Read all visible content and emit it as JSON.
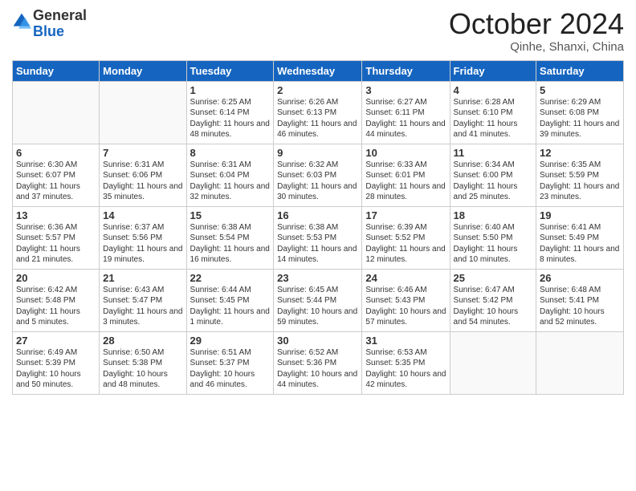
{
  "header": {
    "logo_general": "General",
    "logo_blue": "Blue",
    "month_title": "October 2024",
    "location": "Qinhe, Shanxi, China"
  },
  "weekdays": [
    "Sunday",
    "Monday",
    "Tuesday",
    "Wednesday",
    "Thursday",
    "Friday",
    "Saturday"
  ],
  "weeks": [
    [
      {
        "day": "",
        "info": ""
      },
      {
        "day": "",
        "info": ""
      },
      {
        "day": "1",
        "info": "Sunrise: 6:25 AM\nSunset: 6:14 PM\nDaylight: 11 hours and 48 minutes."
      },
      {
        "day": "2",
        "info": "Sunrise: 6:26 AM\nSunset: 6:13 PM\nDaylight: 11 hours and 46 minutes."
      },
      {
        "day": "3",
        "info": "Sunrise: 6:27 AM\nSunset: 6:11 PM\nDaylight: 11 hours and 44 minutes."
      },
      {
        "day": "4",
        "info": "Sunrise: 6:28 AM\nSunset: 6:10 PM\nDaylight: 11 hours and 41 minutes."
      },
      {
        "day": "5",
        "info": "Sunrise: 6:29 AM\nSunset: 6:08 PM\nDaylight: 11 hours and 39 minutes."
      }
    ],
    [
      {
        "day": "6",
        "info": "Sunrise: 6:30 AM\nSunset: 6:07 PM\nDaylight: 11 hours and 37 minutes."
      },
      {
        "day": "7",
        "info": "Sunrise: 6:31 AM\nSunset: 6:06 PM\nDaylight: 11 hours and 35 minutes."
      },
      {
        "day": "8",
        "info": "Sunrise: 6:31 AM\nSunset: 6:04 PM\nDaylight: 11 hours and 32 minutes."
      },
      {
        "day": "9",
        "info": "Sunrise: 6:32 AM\nSunset: 6:03 PM\nDaylight: 11 hours and 30 minutes."
      },
      {
        "day": "10",
        "info": "Sunrise: 6:33 AM\nSunset: 6:01 PM\nDaylight: 11 hours and 28 minutes."
      },
      {
        "day": "11",
        "info": "Sunrise: 6:34 AM\nSunset: 6:00 PM\nDaylight: 11 hours and 25 minutes."
      },
      {
        "day": "12",
        "info": "Sunrise: 6:35 AM\nSunset: 5:59 PM\nDaylight: 11 hours and 23 minutes."
      }
    ],
    [
      {
        "day": "13",
        "info": "Sunrise: 6:36 AM\nSunset: 5:57 PM\nDaylight: 11 hours and 21 minutes."
      },
      {
        "day": "14",
        "info": "Sunrise: 6:37 AM\nSunset: 5:56 PM\nDaylight: 11 hours and 19 minutes."
      },
      {
        "day": "15",
        "info": "Sunrise: 6:38 AM\nSunset: 5:54 PM\nDaylight: 11 hours and 16 minutes."
      },
      {
        "day": "16",
        "info": "Sunrise: 6:38 AM\nSunset: 5:53 PM\nDaylight: 11 hours and 14 minutes."
      },
      {
        "day": "17",
        "info": "Sunrise: 6:39 AM\nSunset: 5:52 PM\nDaylight: 11 hours and 12 minutes."
      },
      {
        "day": "18",
        "info": "Sunrise: 6:40 AM\nSunset: 5:50 PM\nDaylight: 11 hours and 10 minutes."
      },
      {
        "day": "19",
        "info": "Sunrise: 6:41 AM\nSunset: 5:49 PM\nDaylight: 11 hours and 8 minutes."
      }
    ],
    [
      {
        "day": "20",
        "info": "Sunrise: 6:42 AM\nSunset: 5:48 PM\nDaylight: 11 hours and 5 minutes."
      },
      {
        "day": "21",
        "info": "Sunrise: 6:43 AM\nSunset: 5:47 PM\nDaylight: 11 hours and 3 minutes."
      },
      {
        "day": "22",
        "info": "Sunrise: 6:44 AM\nSunset: 5:45 PM\nDaylight: 11 hours and 1 minute."
      },
      {
        "day": "23",
        "info": "Sunrise: 6:45 AM\nSunset: 5:44 PM\nDaylight: 10 hours and 59 minutes."
      },
      {
        "day": "24",
        "info": "Sunrise: 6:46 AM\nSunset: 5:43 PM\nDaylight: 10 hours and 57 minutes."
      },
      {
        "day": "25",
        "info": "Sunrise: 6:47 AM\nSunset: 5:42 PM\nDaylight: 10 hours and 54 minutes."
      },
      {
        "day": "26",
        "info": "Sunrise: 6:48 AM\nSunset: 5:41 PM\nDaylight: 10 hours and 52 minutes."
      }
    ],
    [
      {
        "day": "27",
        "info": "Sunrise: 6:49 AM\nSunset: 5:39 PM\nDaylight: 10 hours and 50 minutes."
      },
      {
        "day": "28",
        "info": "Sunrise: 6:50 AM\nSunset: 5:38 PM\nDaylight: 10 hours and 48 minutes."
      },
      {
        "day": "29",
        "info": "Sunrise: 6:51 AM\nSunset: 5:37 PM\nDaylight: 10 hours and 46 minutes."
      },
      {
        "day": "30",
        "info": "Sunrise: 6:52 AM\nSunset: 5:36 PM\nDaylight: 10 hours and 44 minutes."
      },
      {
        "day": "31",
        "info": "Sunrise: 6:53 AM\nSunset: 5:35 PM\nDaylight: 10 hours and 42 minutes."
      },
      {
        "day": "",
        "info": ""
      },
      {
        "day": "",
        "info": ""
      }
    ]
  ]
}
